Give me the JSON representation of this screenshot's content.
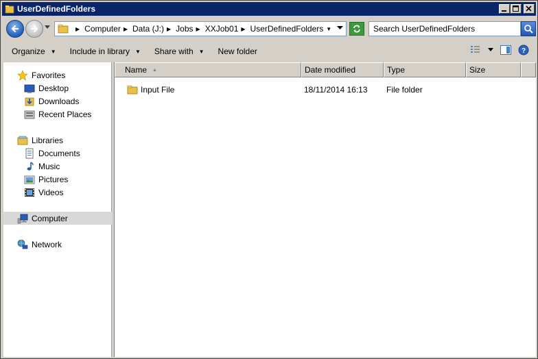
{
  "window": {
    "title": "UserDefinedFolders",
    "minimize_icon": "minimize-icon",
    "maximize_icon": "maximize-icon",
    "close_icon": "close-icon"
  },
  "address_bar": {
    "breadcrumbs": [
      {
        "label": "Computer"
      },
      {
        "label": "Data (J:)"
      },
      {
        "label": "Jobs"
      },
      {
        "label": "XXJob01"
      },
      {
        "label": "UserDefinedFolders"
      }
    ],
    "search_placeholder": "Search UserDefinedFolders"
  },
  "toolbar": {
    "organize": "Organize",
    "include_in_library": "Include in library",
    "share_with": "Share with",
    "new_folder": "New folder"
  },
  "navigation": {
    "favorites": {
      "label": "Favorites",
      "items": [
        {
          "label": "Desktop"
        },
        {
          "label": "Downloads"
        },
        {
          "label": "Recent Places"
        }
      ]
    },
    "libraries": {
      "label": "Libraries",
      "items": [
        {
          "label": "Documents"
        },
        {
          "label": "Music"
        },
        {
          "label": "Pictures"
        },
        {
          "label": "Videos"
        }
      ]
    },
    "computer": {
      "label": "Computer"
    },
    "network": {
      "label": "Network"
    }
  },
  "columns": {
    "name": "Name",
    "date_modified": "Date modified",
    "type": "Type",
    "size": "Size"
  },
  "files": [
    {
      "name": "Input File",
      "date_modified": "18/11/2014 16:13",
      "type": "File folder",
      "size": ""
    }
  ],
  "colors": {
    "title_bar": "#0a246a",
    "selection": "#d9d9d9",
    "folder": "#e8c04a"
  }
}
